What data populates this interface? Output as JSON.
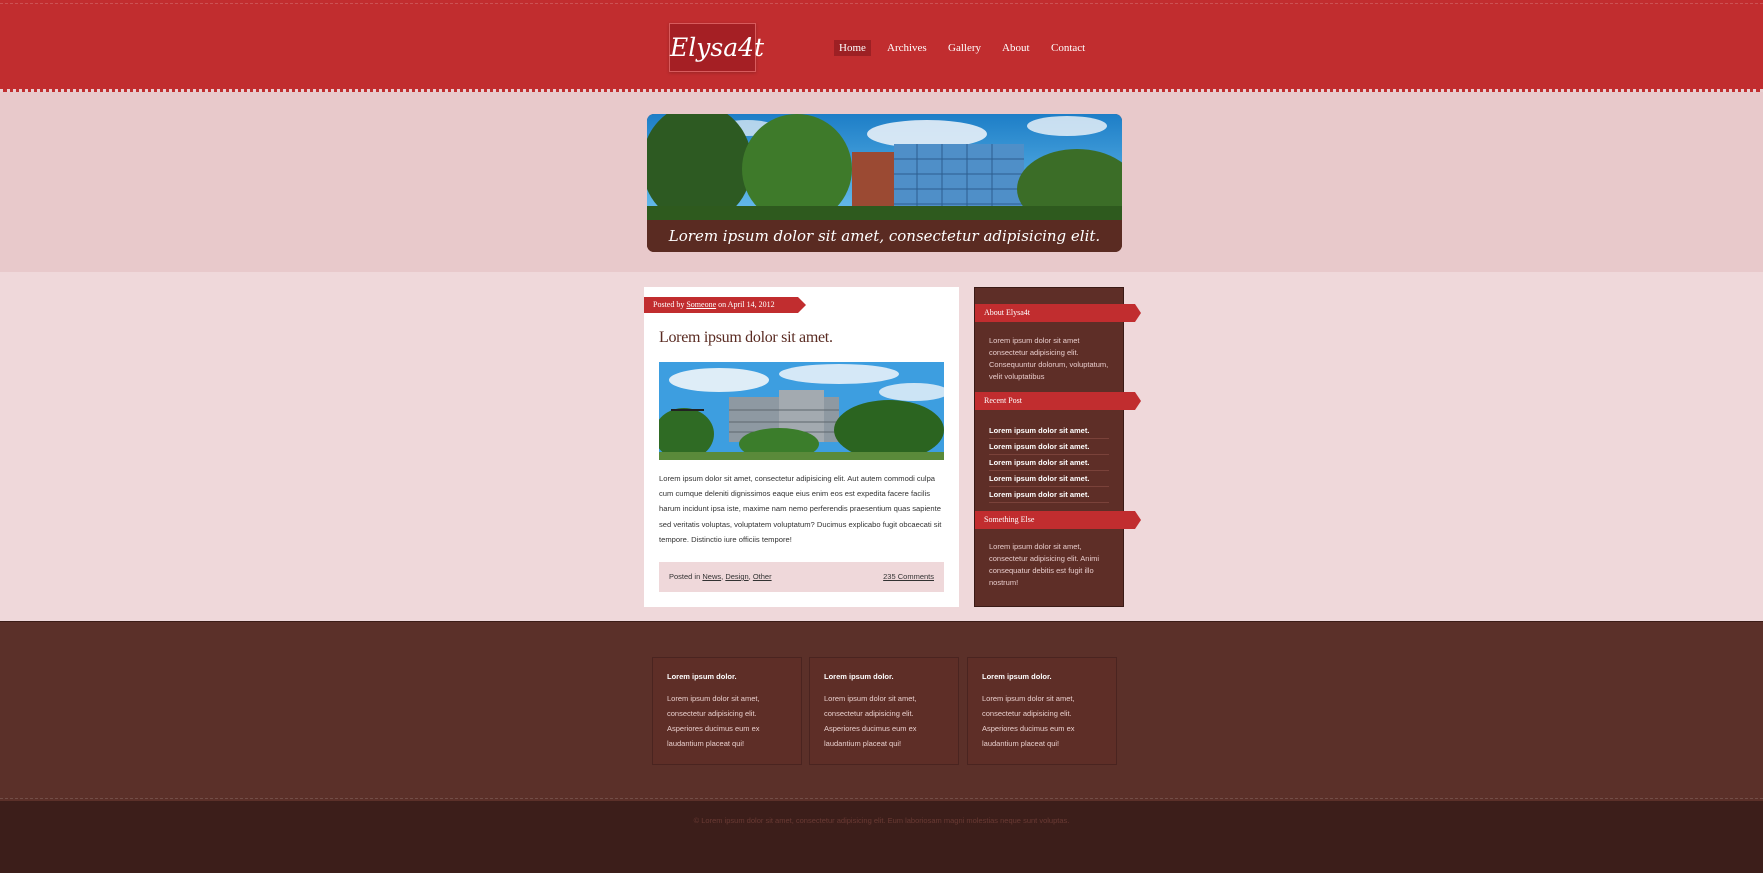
{
  "header": {
    "logo_text": "Elysa4t",
    "nav": [
      {
        "label": "Home",
        "active": true
      },
      {
        "label": "Archives",
        "active": false
      },
      {
        "label": "Gallery",
        "active": false
      },
      {
        "label": "About",
        "active": false
      },
      {
        "label": "Contact",
        "active": false
      }
    ]
  },
  "hero": {
    "caption": "Lorem ipsum dolor sit amet, consectetur adipisicing elit."
  },
  "post": {
    "meta_prefix": "Posted by",
    "author": "Someone",
    "date_text": "on April 14, 2012",
    "title": "Lorem ipsum dolor sit amet.",
    "body": "Lorem ipsum dolor sit amet, consectetur adipisicing elit. Aut autem commodi culpa cum cumque deleniti dignissimos eaque eius enim eos est expedita facere facilis harum incidunt ipsa iste, maxime nam nemo perferendis praesentium quas sapiente sed veritatis voluptas, voluptatem voluptatum? Ducimus explicabo fugit obcaecati sit tempore. Distinctio iure officiis tempore!",
    "posted_in_label": "Posted in",
    "categories": [
      "News",
      "Design",
      "Other"
    ],
    "comments": "235 Comments"
  },
  "sidebar": {
    "about_title": "About Elysa4t",
    "about_text": "Lorem ipsum dolor sit amet consectetur adipisicing elit. Consequuntur dolorum, voluptatum, velit voluptatibus",
    "recent_title": "Recent Post",
    "recent_posts": [
      "Lorem ipsum dolor sit amet.",
      "Lorem ipsum dolor sit amet.",
      "Lorem ipsum dolor sit amet.",
      "Lorem ipsum dolor sit amet.",
      "Lorem ipsum dolor sit amet."
    ],
    "else_title": "Something Else",
    "else_text": "Lorem ipsum dolor sit amet, consectetur adipisicing elit. Animi consequatur debitis est fugit illo nostrum!"
  },
  "footer": {
    "boxes": [
      {
        "title": "Lorem ipsum dolor.",
        "text": "Lorem ipsum dolor sit amet, consectetur adipisicing elit. Asperiores ducimus eum ex laudantium placeat qui!"
      },
      {
        "title": "Lorem ipsum dolor.",
        "text": "Lorem ipsum dolor sit amet, consectetur adipisicing elit. Asperiores ducimus eum ex laudantium placeat qui!"
      },
      {
        "title": "Lorem ipsum dolor.",
        "text": "Lorem ipsum dolor sit amet, consectetur adipisicing elit. Asperiores ducimus eum ex laudantium placeat qui!"
      }
    ],
    "copyright": "© Lorem ipsum dolor sit amet, consectetur adipisicing elit. Eum laboriosam magni molestias neque sunt voluptas."
  },
  "colors": {
    "header_red": "#c12d2f",
    "hero_band": "#e8c9cb",
    "main_band": "#efd8da",
    "footer_brown": "#5b3029",
    "copyright_band": "#3c1e1a"
  }
}
